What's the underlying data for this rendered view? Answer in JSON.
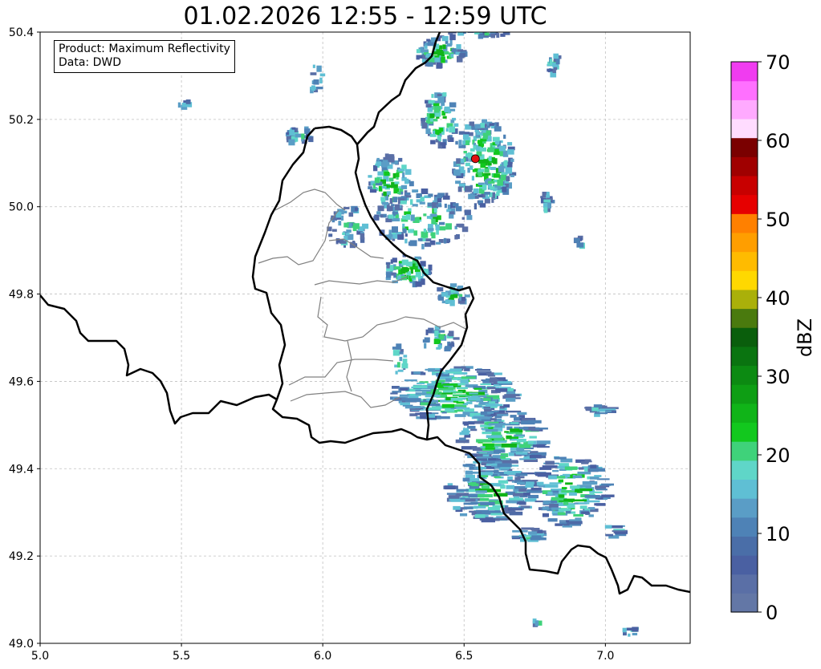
{
  "title": "01.02.2026 12:55 - 12:59 UTC",
  "info_box": {
    "product_line": "Product: Maximum Reflectivity",
    "data_line": "Data: DWD"
  },
  "axes": {
    "x_ticks": [
      "5.0",
      "5.5",
      "6.0",
      "6.5",
      "7.0"
    ],
    "y_ticks": [
      "49.0",
      "49.2",
      "49.4",
      "49.6",
      "49.8",
      "50.0",
      "50.2",
      "50.4"
    ],
    "lon_range": [
      5.0,
      7.3
    ],
    "lat_range": [
      49.0,
      50.4
    ],
    "grid": true
  },
  "colorbar": {
    "label": "dBZ",
    "ticks": [
      "0",
      "10",
      "20",
      "30",
      "40",
      "50",
      "60",
      "70"
    ],
    "range": [
      0,
      70
    ],
    "colors": [
      "#6377a6",
      "#5a6fa6",
      "#4a60a2",
      "#4a6ea8",
      "#4e82b6",
      "#5a9dc6",
      "#5fbfd4",
      "#5fd6c8",
      "#3fd27a",
      "#12c81e",
      "#10b418",
      "#0e9e14",
      "#0c8a12",
      "#0a7410",
      "#0a5e0c",
      "#4a7a0e",
      "#aab00a",
      "#ffd800",
      "#ffbb00",
      "#ff9e00",
      "#ff8000",
      "#e60000",
      "#c80000",
      "#a00000",
      "#7a0000",
      "#ffdcff",
      "#ffaaff",
      "#ff70ff",
      "#f03cf0"
    ]
  },
  "marker": {
    "lon": 6.54,
    "lat": 50.11,
    "color": "#e01010"
  },
  "map_colors": {
    "country_border": "#000000",
    "admin_border": "#808080",
    "grid": "#c0c0c0"
  }
}
